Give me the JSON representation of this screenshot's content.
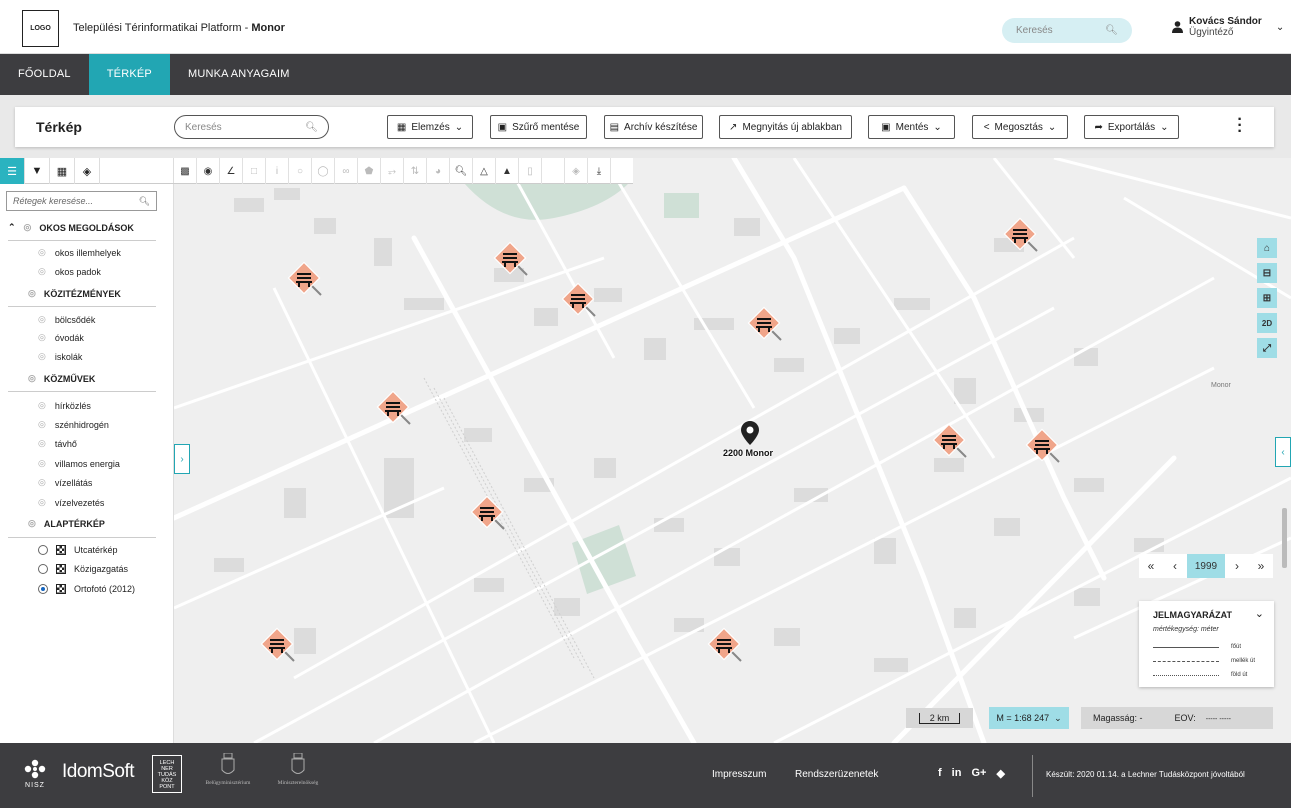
{
  "header": {
    "logo": "LOGO",
    "title_prefix": "Települési Térinformatikai Platform - ",
    "title_city": "Monor",
    "search_placeholder": "Keresés",
    "user_name": "Kovács Sándor",
    "user_role": "Ügyintéző"
  },
  "nav": {
    "items": [
      {
        "label": "FŐOLDAL"
      },
      {
        "label": "TÉRKÉP"
      },
      {
        "label": "MUNKA ANYAGAIM"
      }
    ]
  },
  "toolbar": {
    "title": "Térkép",
    "search_placeholder": "Keresés",
    "analysis": "Elemzés",
    "save_filter": "Szűrő mentése",
    "archive": "Archív készítése",
    "open_window": "Megnyitás új ablakban",
    "save": "Mentés",
    "share": "Megosztás",
    "export": "Exportálás"
  },
  "layers": {
    "search_placeholder": "Rétegek keresése...",
    "groups": [
      {
        "label": "OKOS MEGOLDÁSOK",
        "items": [
          "okos illemhelyek",
          "okos padok"
        ]
      },
      {
        "label": "KÖZITÉZMÉNYEK",
        "items": [
          "bölcsődék",
          "óvodák",
          "iskolák"
        ]
      },
      {
        "label": "KÖZMŰVEK",
        "items": [
          "hírközlés",
          "szénhidrogén",
          "távhő",
          "villamos energia",
          "vízellátás",
          "vízelvezetés"
        ]
      },
      {
        "label": "ALAPTÉRKÉP",
        "items": []
      }
    ],
    "basemaps": [
      {
        "label": "Utcatérkép",
        "selected": false
      },
      {
        "label": "Közigazgatás",
        "selected": false
      },
      {
        "label": "Ortofotó (2012)",
        "selected": true
      }
    ]
  },
  "map": {
    "pin_label": "2200 Monor",
    "place_label": "Monor",
    "zoom_2d": "2D",
    "year": "1999",
    "scale_bar": "2 km",
    "scale_ratio": "M = 1:68 247",
    "height_label": "Magasság: -",
    "eov_label": "EOV:",
    "eov_value": "----- -----"
  },
  "legend": {
    "title": "JELMAGYARÁZAT",
    "subtitle": "mértékegység: méter",
    "rows": [
      {
        "label": "főút",
        "style": "solid"
      },
      {
        "label": "mellék út",
        "style": "dash-long"
      },
      {
        "label": "föld út",
        "style": "dash-short"
      }
    ]
  },
  "footer": {
    "nisz": "NISZ",
    "idomsoft": "IdomSoft",
    "lechner": "LECH NER TUDÁS KÖZ PONT",
    "ministry1": "Belügyminisztérium",
    "ministry2": "Miniszterelnökség",
    "impressum": "Impresszum",
    "system_messages": "Rendszerüzenetek",
    "credit": "Készült: 2020 01.14. a Lechner Tudásközpont jóvoltából"
  },
  "colors": {
    "accent": "#22a6b3",
    "nav_bg": "#3d3d40",
    "marker": "#f0a58a"
  }
}
